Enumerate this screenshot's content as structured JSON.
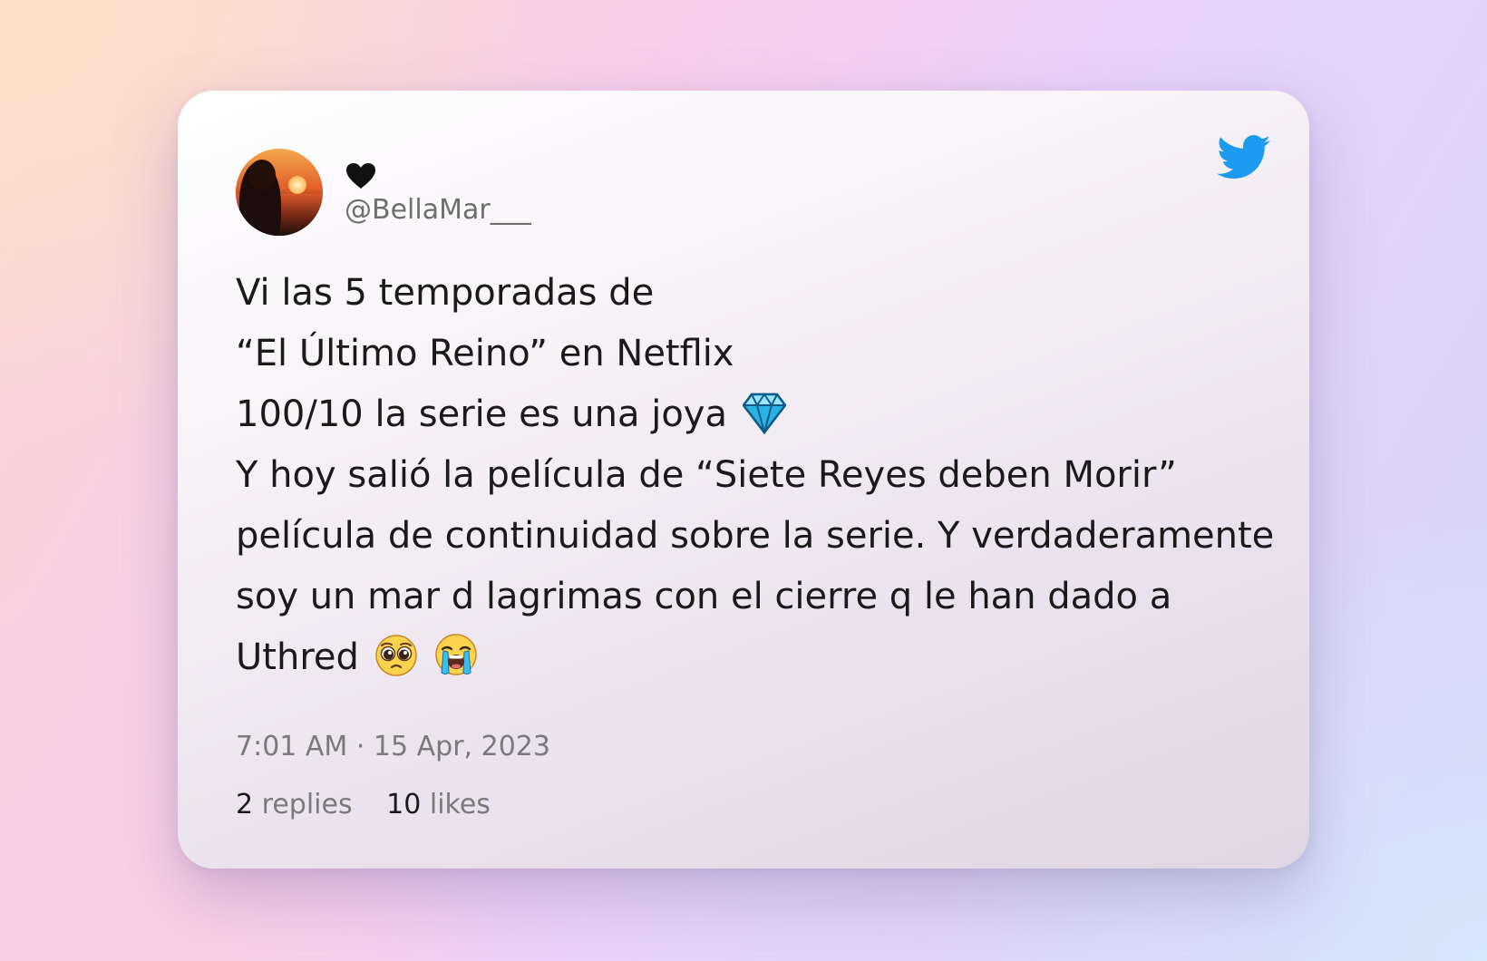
{
  "tweet": {
    "author": {
      "display_icon": "black-heart-icon",
      "handle": "@BellaMar___"
    },
    "text_lines": [
      "Vi las 5 temporadas de",
      "“El Último Reino” en Netflix",
      "100/10 la serie es una joya",
      "Y hoy salió la película de “Siete Reyes deben Morir”",
      "película de continuidad sobre la serie. Y verdaderamente",
      "soy un mar d lagrimas con el cierre q le han dado a",
      "Uthred"
    ],
    "emojis": {
      "line3": "gem-stone-emoji",
      "line7": [
        "pleading-face-emoji",
        "loudly-crying-face-emoji"
      ]
    },
    "timestamp": "7:01 AM · 15 Apr, 2023",
    "stats": {
      "replies_count": "2",
      "replies_label": "replies",
      "likes_count": "10",
      "likes_label": "likes"
    }
  },
  "colors": {
    "twitter_blue": "#1d9bf0",
    "text": "#1a1a1a",
    "muted": "#7a7a7a"
  }
}
